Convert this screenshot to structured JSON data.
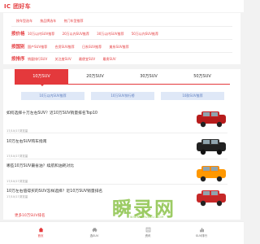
{
  "header": {
    "logo_text": "IC 团好车"
  },
  "filters": {
    "rows": [
      {
        "tag": "",
        "links": [
          "按车型选车",
          "按品牌选车",
          "热门车型推荐"
        ]
      },
      {
        "tag": "按价格",
        "links": [
          "10万以内SUV推荐",
          "20万以内SUV推荐",
          "30万以内SUV推荐",
          "50万以内SUV推荐"
        ]
      },
      {
        "tag": "按国别",
        "links": [
          "国产SUV推荐",
          "合资SUV推荐",
          "日系SUV推荐",
          "美系SUV推荐"
        ]
      },
      {
        "tag": "按排序",
        "links": [
          "销量排行SUV",
          "关注度SUV",
          "最便宜SUV",
          "最贵SUV"
        ]
      }
    ]
  },
  "tabs": {
    "items": [
      "10万SUV",
      "20万SUV",
      "30万SUV",
      "50万SUV"
    ],
    "active_index": 0
  },
  "subtabs": [
    "10万以内SUV推荐",
    "10万SUV排行榜",
    "10款SUV推荐"
  ],
  "articles": [
    {
      "title": "如何选择十万左右SUV？近10万SUV销量排名Top10",
      "meta": "17/10/17浏览量"
    },
    {
      "title": "10万左右SUV购车指南",
      "meta": "17/10/17浏览量"
    },
    {
      "title": "哪些10万SUV最省油？续航和油耗对比",
      "meta": "17/10/17浏览量"
    },
    {
      "title": "10万左右值得买的SUV怎样选择？近10万SUV销量排名",
      "meta": "17/10/17浏览量"
    }
  ],
  "more_link": "更多10万SUV排名",
  "bottom_nav": [
    {
      "label": "首页",
      "icon": "home-icon"
    },
    {
      "label": "选SUV",
      "icon": "car-icon"
    },
    {
      "label": "资讯",
      "icon": "news-icon"
    },
    {
      "label": "SUV排行",
      "icon": "ranking-icon"
    }
  ],
  "watermark": {
    "text": "瞬录网",
    "sub": "WWW.SHUNLU.COM"
  },
  "colors": {
    "accent": "#e4393c",
    "subtab_bg": "#dfe8f7",
    "watermark": "#8bc34a"
  }
}
